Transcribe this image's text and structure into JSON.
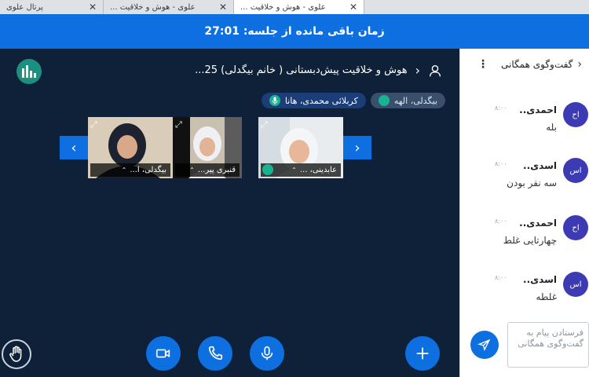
{
  "browser": {
    "tabs": [
      {
        "title": "پرتال علوی",
        "active": false
      },
      {
        "title": "علوی - هوش و خلاقیت ...",
        "active": false
      },
      {
        "title": "علوی - هوش و خلاقیت ...",
        "active": true
      }
    ]
  },
  "banner": {
    "text": "زمان باقی مانده از جلسه: 27:01"
  },
  "session": {
    "title": "هوش و خلاقیت پیش‌دبستانی ( خانم بیگدلی) 25...",
    "talking": [
      {
        "label": "بیگدلی، الهه"
      },
      {
        "label": "کربلائی محمدی، هانا"
      }
    ]
  },
  "videos": [
    {
      "name": "عابدینی، ...",
      "talking": true
    },
    {
      "name": "قنبری پیر...",
      "talking": false
    },
    {
      "name": "بیگدلی، ا...",
      "talking": false
    }
  ],
  "controls": {
    "video": "camera-icon",
    "phone": "phone-icon",
    "mic": "microphone-icon",
    "actions": "plus-icon",
    "raise_hand": "hand-icon"
  },
  "chat": {
    "title": "گفت‌وگوی همگانی",
    "messages": [
      {
        "initials": "اح",
        "author": "احمدی..",
        "time": "۸:۰۰",
        "text": "بله"
      },
      {
        "initials": "اس",
        "author": "اسدی..",
        "time": "۸:۰۰",
        "text": "سه نفر بودن"
      },
      {
        "initials": "اح",
        "author": "احمدی..",
        "time": "۸:۰۰",
        "text": "چهارتایی غلط"
      },
      {
        "initials": "اس",
        "author": "اسدی..",
        "time": "۸:۰۰",
        "text": "غلطه"
      }
    ],
    "input_placeholder": "فرستادن پیام به گفت‌وگوی همگانی"
  },
  "colors": {
    "accent": "#0d6fe0",
    "stage": "#0f2138",
    "talk": "#19b394",
    "avatar": "#3d3bb3"
  }
}
